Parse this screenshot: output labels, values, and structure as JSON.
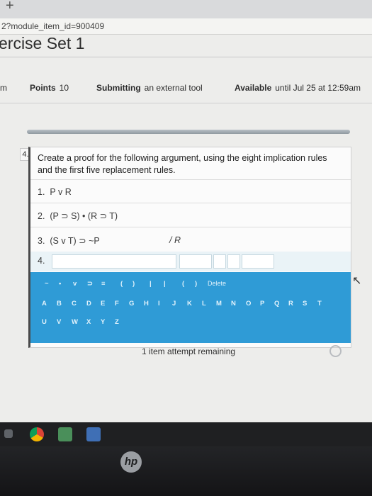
{
  "browser": {
    "new_tab": "+",
    "url": "2?module_item_id=900409"
  },
  "page": {
    "title": "ercise Set 1"
  },
  "meta": {
    "lead_fragment": "m",
    "points_label": "Points",
    "points_value": "10",
    "submitting_label": "Submitting",
    "submitting_value": "an external tool",
    "available_label": "Available",
    "available_value": "until Jul 25 at 12:59am"
  },
  "question": {
    "number": "4.",
    "prompt": "Create a proof for the following argument, using the eight implication rules and the first five replacement rules.",
    "premises": [
      {
        "num": "1.",
        "text": "P v R"
      },
      {
        "num": "2.",
        "text": "(P ⊃ S) • (R ⊃ T)"
      },
      {
        "num": "3.",
        "text": "(S v T) ⊃ ~P"
      }
    ],
    "conclusion": "/ R",
    "step4_num": "4."
  },
  "palette": {
    "symbols": [
      "~",
      "•",
      "v",
      "⊃",
      "≡",
      "(",
      ")",
      "|",
      "|",
      "(",
      ")"
    ],
    "delete_label": "Delete",
    "letters_row1": [
      "A",
      "B",
      "C",
      "D",
      "E",
      "F",
      "G",
      "H",
      "I",
      "J",
      "K",
      "L",
      "M",
      "N",
      "O",
      "P",
      "Q",
      "R",
      "S",
      "T"
    ],
    "letters_row2": [
      "U",
      "V",
      "W",
      "X",
      "Y",
      "Z"
    ]
  },
  "footer": {
    "attempts": "1 item attempt remaining"
  },
  "device": {
    "logo": "hp"
  }
}
